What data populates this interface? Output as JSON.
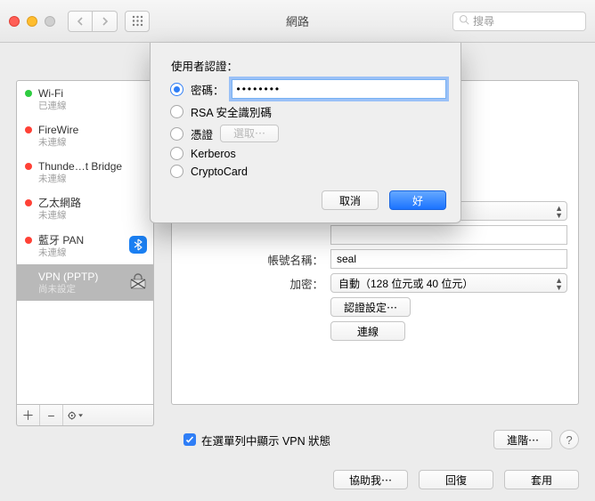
{
  "window": {
    "title": "網路",
    "search_placeholder": "搜尋"
  },
  "sidebar": {
    "items": [
      {
        "name": "Wi-Fi",
        "status": "已連線",
        "dot": "green"
      },
      {
        "name": "FireWire",
        "status": "未連線",
        "dot": "red"
      },
      {
        "name": "Thunde…t Bridge",
        "status": "未連線",
        "dot": "red"
      },
      {
        "name": "乙太網路",
        "status": "未連線",
        "dot": "red"
      },
      {
        "name": "藍牙 PAN",
        "status": "未連線",
        "dot": "red",
        "badge": "bluetooth"
      },
      {
        "name": "VPN (PPTP)",
        "status": "尚未設定",
        "dot": "none",
        "badge": "lock",
        "selected": true
      }
    ]
  },
  "detail": {
    "account_label": "帳號名稱：",
    "account_value": "seal",
    "encryption_label": "加密：",
    "encryption_value": "自動（128 位元或 40 位元）",
    "auth_settings_btn": "認證設定⋯",
    "connect_btn": "連線",
    "show_vpn_label": "在選單列中顯示 VPN 狀態",
    "advanced_btn": "進階⋯"
  },
  "footer": {
    "assist": "協助我⋯",
    "revert": "回復",
    "apply": "套用"
  },
  "sheet": {
    "header": "使用者認證：",
    "options": [
      {
        "label": "密碼：",
        "selected": true,
        "value": "••••••••"
      },
      {
        "label": "RSA 安全識別碼"
      },
      {
        "label": "憑證",
        "select_btn": "選取⋯"
      },
      {
        "label": "Kerberos"
      },
      {
        "label": "CryptoCard"
      }
    ],
    "cancel": "取消",
    "ok": "好"
  }
}
